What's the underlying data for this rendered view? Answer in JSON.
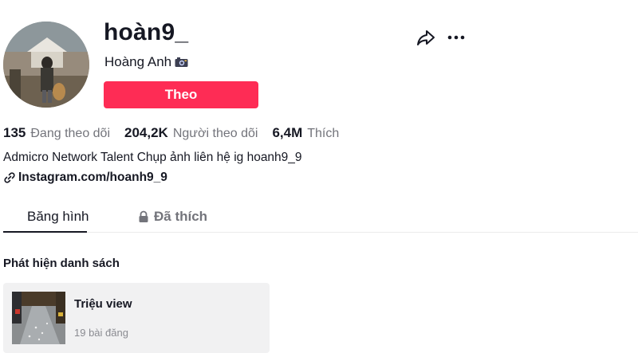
{
  "profile": {
    "username": "hoàn9_",
    "nickname": "Hoàng Anh",
    "follow_label": "Theo"
  },
  "stats": [
    {
      "value": "135",
      "label": "Đang theo dõi"
    },
    {
      "value": "204,2K",
      "label": "Người theo dõi"
    },
    {
      "value": "6,4M",
      "label": "Thích"
    }
  ],
  "bio": "Admicro Network Talent Chụp ảnh liên hệ ig hoanh9_9",
  "link": "Instagram.com/hoanh9_9",
  "tabs": [
    {
      "label": "Băng hình",
      "active": true
    },
    {
      "label": "Đã thích",
      "locked": true
    }
  ],
  "playlists": {
    "section_title": "Phát hiện danh sách",
    "items": [
      {
        "title": "Triệu view",
        "count": "19 bài đăng"
      }
    ]
  },
  "colors": {
    "accent": "#fe2c55",
    "text": "#161823",
    "muted": "#73747b"
  },
  "icons": [
    "camera-icon",
    "share-icon",
    "more-icon",
    "link-icon",
    "lock-icon"
  ]
}
